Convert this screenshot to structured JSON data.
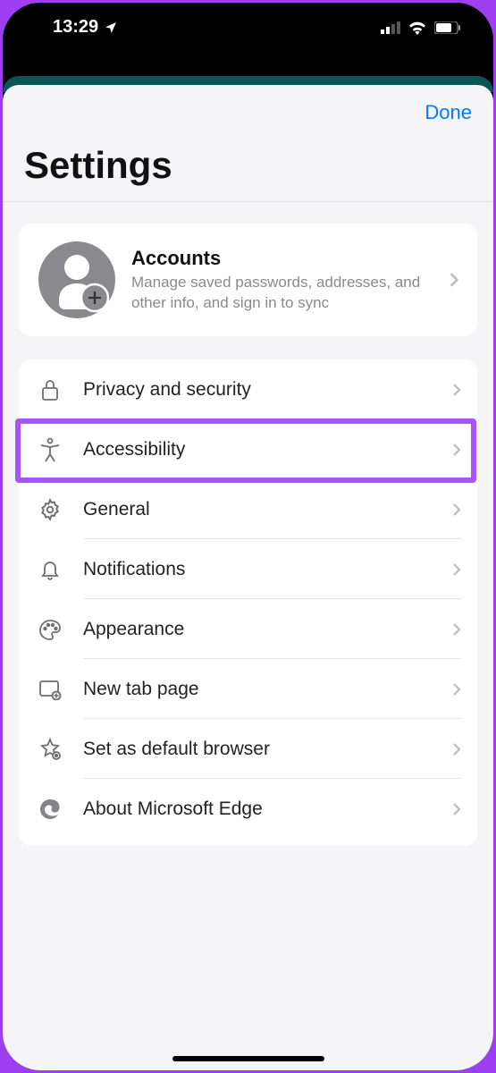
{
  "status": {
    "time": "13:29"
  },
  "header": {
    "done": "Done",
    "title": "Settings"
  },
  "accounts": {
    "title": "Accounts",
    "subtitle": "Manage saved passwords, addresses, and other info, and sign in to sync"
  },
  "rows": [
    {
      "icon": "lock-icon",
      "label": "Privacy and security",
      "highlighted": true
    },
    {
      "icon": "accessibility-icon",
      "label": "Accessibility"
    },
    {
      "icon": "gear-icon",
      "label": "General"
    },
    {
      "icon": "bell-icon",
      "label": "Notifications"
    },
    {
      "icon": "palette-icon",
      "label": "Appearance"
    },
    {
      "icon": "new-tab-icon",
      "label": "New tab page"
    },
    {
      "icon": "star-gear-icon",
      "label": "Set as default browser"
    },
    {
      "icon": "edge-icon",
      "label": "About Microsoft Edge"
    }
  ]
}
